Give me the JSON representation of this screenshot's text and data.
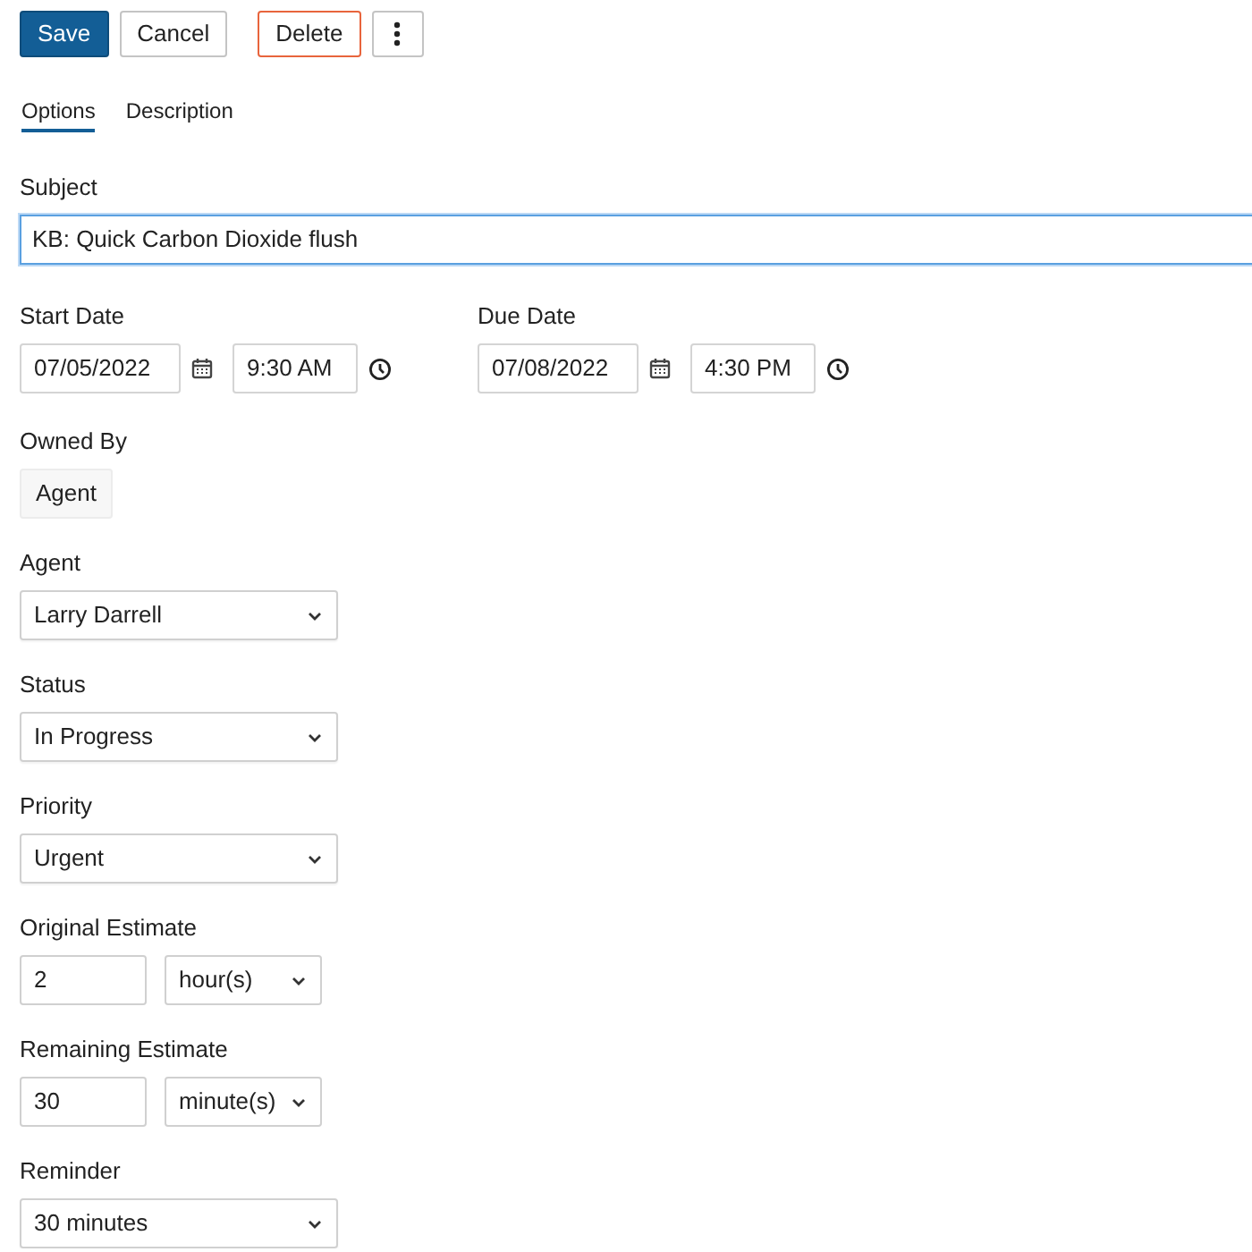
{
  "toolbar": [
    {
      "label": "Save",
      "kind": "primary"
    },
    {
      "label": "Cancel",
      "kind": "default"
    },
    {
      "label": "Delete",
      "kind": "danger"
    },
    {
      "kind": "more"
    }
  ],
  "tabs": [
    {
      "label": "Options",
      "selected": true
    },
    {
      "label": "Description",
      "selected": false
    }
  ],
  "subject": {
    "label": "Subject",
    "value": "KB: Quick Carbon Dioxide flush",
    "focused": true
  },
  "dates": [
    {
      "label": "Start Date",
      "date": "07/05/2022",
      "time": "9:30 AM"
    },
    {
      "label": "Due Date",
      "date": "07/08/2022",
      "time": "4:30 PM"
    }
  ],
  "owned_by": {
    "label": "Owned By",
    "value": "Agent"
  },
  "fields": [
    {
      "kind": "select",
      "label": "Agent",
      "value": "Larry Darrell"
    },
    {
      "kind": "select",
      "label": "Status",
      "value": "In Progress"
    },
    {
      "kind": "select",
      "label": "Priority",
      "value": "Urgent"
    },
    {
      "kind": "estimate",
      "label": "Original Estimate",
      "value": "2",
      "unit": "hour(s)"
    },
    {
      "kind": "estimate",
      "label": "Remaining Estimate",
      "value": "30",
      "unit": "minute(s)"
    },
    {
      "kind": "select",
      "label": "Reminder",
      "value": "30 minutes"
    }
  ]
}
